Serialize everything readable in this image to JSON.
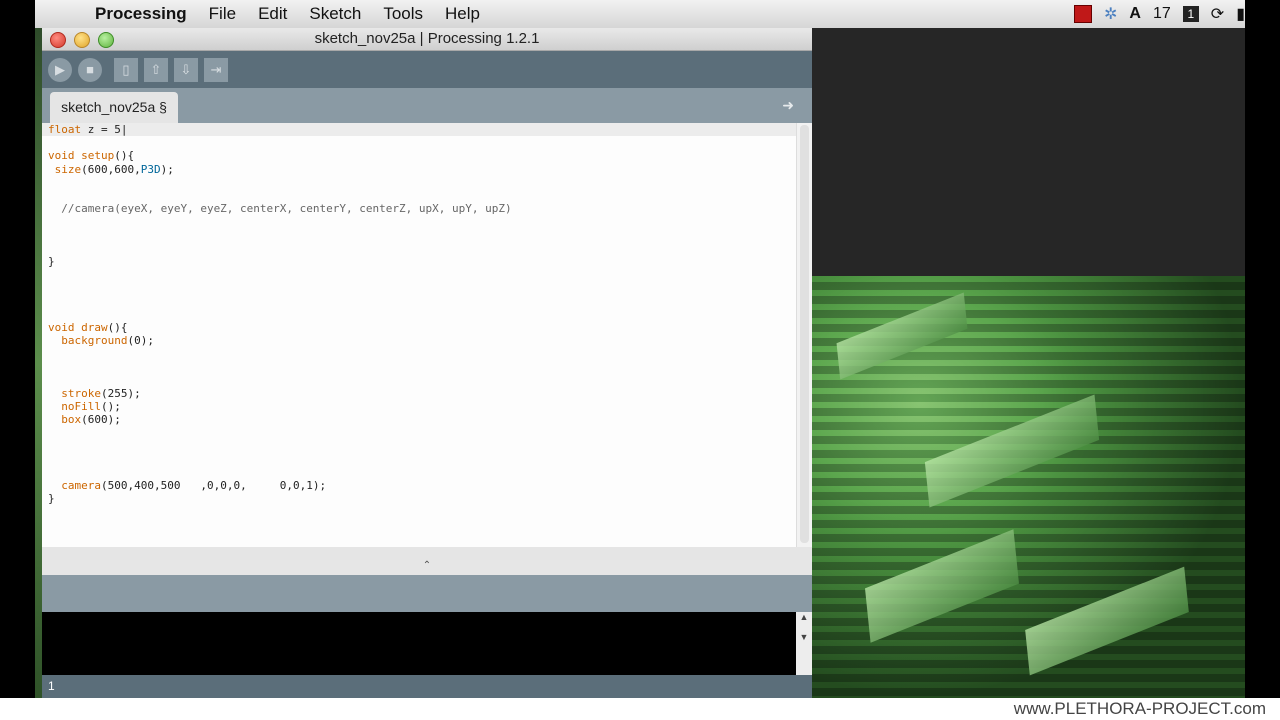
{
  "menubar": {
    "app": "Processing",
    "items": [
      "File",
      "Edit",
      "Sketch",
      "Tools",
      "Help"
    ],
    "status_count": "17"
  },
  "window": {
    "title": "sketch_nov25a | Processing 1.2.1",
    "tab": "sketch_nov25a §",
    "status_line": "1"
  },
  "code_lines": [
    "float z = 5|",
    "",
    "void setup(){",
    " size(600,600,P3D);",
    "",
    "",
    "  //camera(eyeX, eyeY, eyeZ, centerX, centerY, centerZ, upX, upY, upZ)",
    "",
    "",
    "",
    "}",
    "",
    "",
    "",
    "",
    "void draw(){",
    "  background(0);",
    "",
    "",
    "",
    "  stroke(255);",
    "  noFill();",
    "  box(600);",
    "",
    "",
    "",
    "",
    "  camera(500,400,500   ,0,0,0,     0,0,1);",
    "}"
  ],
  "watermark": "www.PLETHORA-PROJECT.com",
  "colors": {
    "toolbar": "#5b6e7a",
    "keyword": "#cc6600",
    "constant": "#006699"
  }
}
